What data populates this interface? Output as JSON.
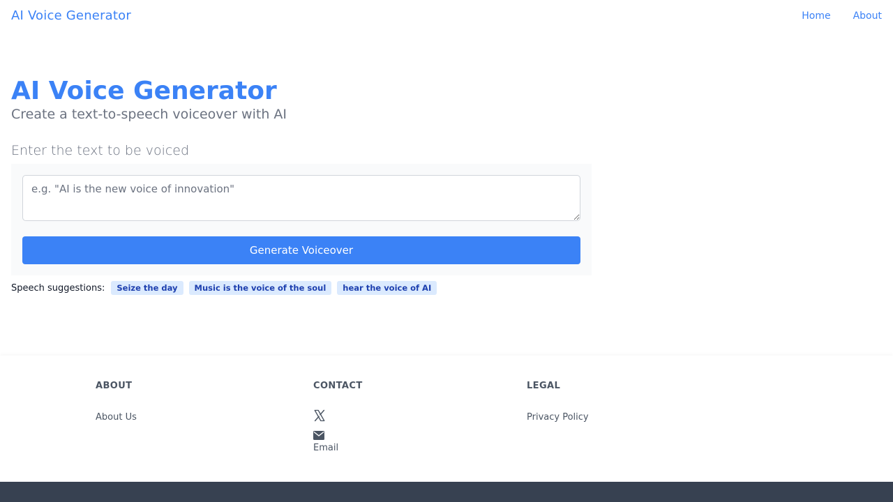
{
  "header": {
    "brand": "AI Voice Generator",
    "nav": [
      "Home",
      "About"
    ]
  },
  "hero": {
    "title": "AI Voice Generator",
    "subtitle": "Create a text-to-speech voiceover with AI"
  },
  "form": {
    "label": "Enter the text to be voiced",
    "placeholder": "e.g. \"AI is the new voice of innovation\"",
    "value": "",
    "button_label": "Generate Voiceover"
  },
  "suggestions": {
    "label": "Speech suggestions:",
    "items": [
      "Seize the day",
      "Music is the voice of the soul",
      "hear the voice of AI"
    ]
  },
  "footer": {
    "about": {
      "heading": "ABOUT",
      "link": "About Us"
    },
    "contact": {
      "heading": "CONTACT",
      "icons": [
        "x-icon",
        "mail-icon"
      ],
      "email_label": "Email"
    },
    "legal": {
      "heading": "LEGAL",
      "link": "Privacy Policy"
    }
  },
  "colors": {
    "accent": "#3b82f6",
    "chip_bg": "#dbeafe",
    "chip_text": "#1e40af",
    "bottom_bar": "#374151"
  }
}
